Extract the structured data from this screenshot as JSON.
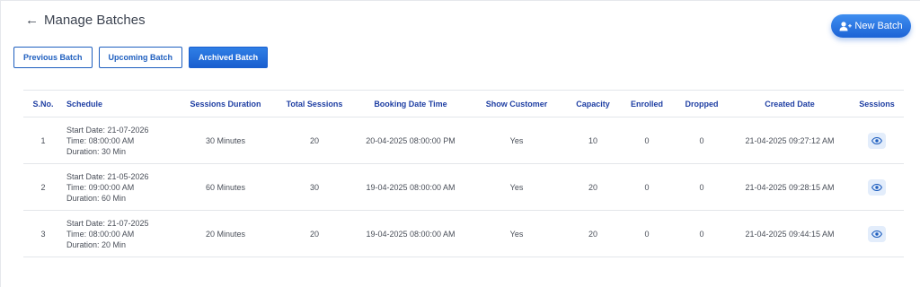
{
  "header": {
    "back_icon": "←",
    "title": "Manage Batches"
  },
  "new_batch": {
    "label": "New Batch",
    "icon": "user-plus-icon"
  },
  "tabs": [
    {
      "label": "Previous Batch",
      "active": false
    },
    {
      "label": "Upcoming Batch",
      "active": false
    },
    {
      "label": "Archived Batch",
      "active": true
    }
  ],
  "table": {
    "columns": [
      "S.No.",
      "Schedule",
      "Sessions Duration",
      "Total Sessions",
      "Booking Date Time",
      "Show Customer",
      "Capacity",
      "Enrolled",
      "Dropped",
      "Created Date",
      "Sessions"
    ],
    "rows": [
      {
        "sno": "1",
        "schedule": {
          "start": "Start Date: 21-07-2026",
          "time": "Time: 08:00:00 AM",
          "duration": "Duration: 30 Min"
        },
        "sessions_duration": "30 Minutes",
        "total_sessions": "20",
        "booking_date_time": "20-04-2025 08:00:00 PM",
        "show_customer": "Yes",
        "capacity": "10",
        "enrolled": "0",
        "dropped": "0",
        "created_date": "21-04-2025 09:27:12 AM"
      },
      {
        "sno": "2",
        "schedule": {
          "start": "Start Date: 21-05-2026",
          "time": "Time: 09:00:00 AM",
          "duration": "Duration: 60 Min"
        },
        "sessions_duration": "60 Minutes",
        "total_sessions": "30",
        "booking_date_time": "19-04-2025 08:00:00 AM",
        "show_customer": "Yes",
        "capacity": "20",
        "enrolled": "0",
        "dropped": "0",
        "created_date": "21-04-2025 09:28:15 AM"
      },
      {
        "sno": "3",
        "schedule": {
          "start": "Start Date: 21-07-2025",
          "time": "Time: 08:00:00 AM",
          "duration": "Duration: 20 Min"
        },
        "sessions_duration": "20 Minutes",
        "total_sessions": "20",
        "booking_date_time": "19-04-2025 08:00:00 AM",
        "show_customer": "Yes",
        "capacity": "20",
        "enrolled": "0",
        "dropped": "0",
        "created_date": "21-04-2025 09:44:15 AM"
      }
    ],
    "sessions_icon": "eye-icon"
  },
  "colors": {
    "accent": "#1f5fbf",
    "header_text": "#1f3fa3",
    "eye_bg": "#e3edfb"
  }
}
